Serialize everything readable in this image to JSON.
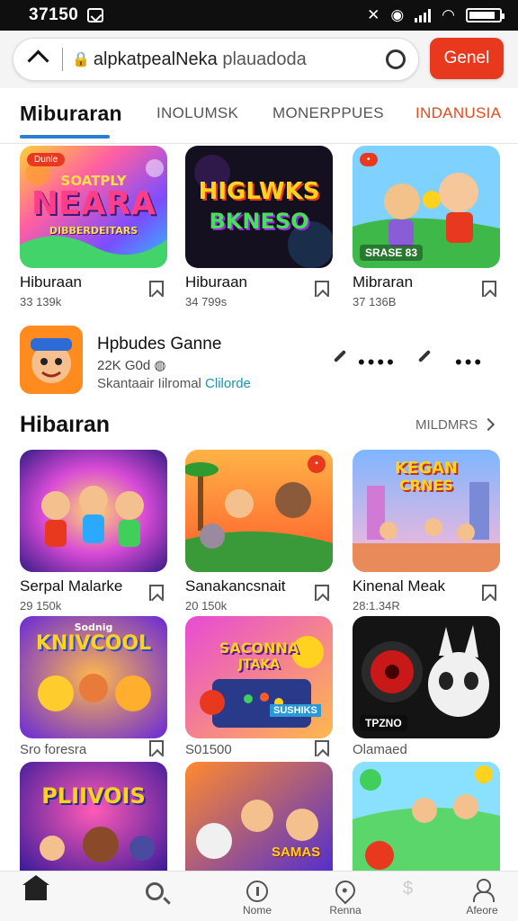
{
  "status_bar": {
    "time": "37150"
  },
  "browser": {
    "url_main": "alpkatpealNeka",
    "url_muted": " plauadoda",
    "action_button": "Genel"
  },
  "tabs": [
    {
      "label": "Miburaran"
    },
    {
      "label": "INOLUMSK"
    },
    {
      "label": "MONERPPUES"
    },
    {
      "label": "INDANUSIA"
    }
  ],
  "featured_cards": [
    {
      "title": "Hiburaan",
      "meta": "33 139k",
      "art_text_1": "SOATPLY",
      "art_text_2": "NEARA",
      "art_text_3": "DIBBERDEITARS",
      "badge": "Dunle"
    },
    {
      "title": "Hiburaan",
      "meta": "34 799s",
      "art_text_1": "HIGLWKS",
      "art_text_2": "BKNESO"
    },
    {
      "title": "Mibraran",
      "meta": "37 136B",
      "overlay": "SRASE 83"
    }
  ],
  "feature": {
    "title": "Hpbudes Ganne",
    "meta": "22K G0d",
    "sub": "Skantaair Iilromal ",
    "sub_link": "Clilorde"
  },
  "section": {
    "title": "Hibaıran",
    "see_more": "MILDMRS"
  },
  "grid_cards": [
    {
      "title": "Serpal Malarke",
      "meta": "29 150k"
    },
    {
      "title": "Sanakancsnait",
      "meta": "20 150k"
    },
    {
      "title": "Kinenal Meak",
      "meta": "28:1.34R",
      "art_text_1": "KEGAN",
      "art_text_2": "CRNES"
    },
    {
      "title": "",
      "meta": "Sro foresra",
      "art_text_1": "Sodnig",
      "art_text_2": "KNIVCOOL"
    },
    {
      "title": "",
      "meta": "S01500",
      "art_text_1": "SACONNA",
      "art_text_2": "JTAKA",
      "art_text_3": "SUSHIKS"
    },
    {
      "title": "",
      "meta": "Olamaed",
      "overlay": "TPZNO"
    },
    {
      "title": "",
      "meta": "",
      "art_text_1": "PLIIVOIS"
    },
    {
      "title": "",
      "meta": "",
      "art_text_1": "SAMAS"
    },
    {
      "title": "",
      "meta": ""
    }
  ],
  "bottom_nav": [
    {
      "label": "",
      "icon": "home-icon"
    },
    {
      "label": "",
      "icon": "search-icon"
    },
    {
      "label": "Nome",
      "icon": "info-icon"
    },
    {
      "label": "Renna",
      "icon": "pin-icon"
    },
    {
      "label": "",
      "icon": "dollar-icon"
    },
    {
      "label": "Afeore",
      "icon": "user-icon"
    }
  ],
  "colors": {
    "accent": "#e8391f",
    "tab_underline": "#2a7fd0",
    "link": "#1a93b8"
  }
}
